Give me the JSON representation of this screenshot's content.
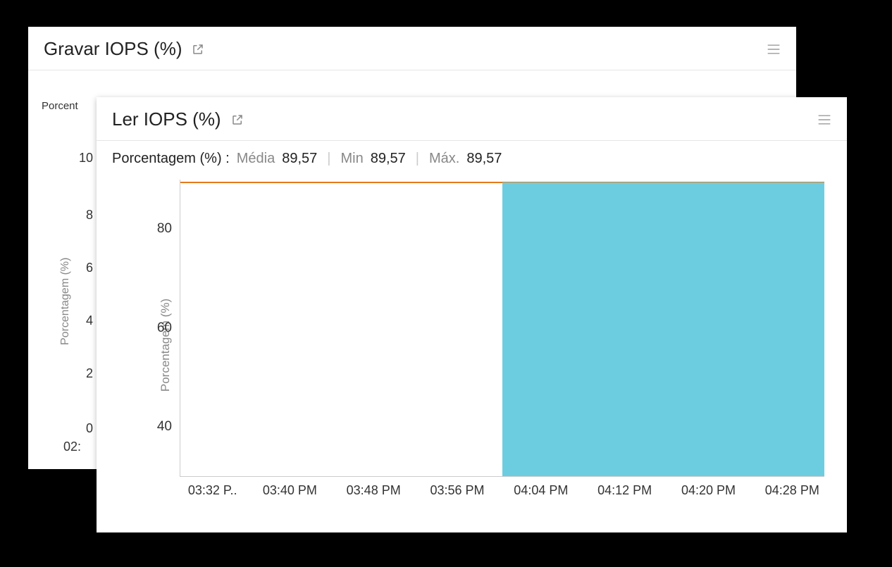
{
  "back_panel": {
    "title": "Gravar IOPS (%)",
    "y_label_truncated": "Porcent",
    "y_axis_rotated": "Porcentagem (%)",
    "y_ticks": [
      "10",
      "8",
      "6",
      "4",
      "2",
      "0"
    ],
    "x_tick_truncated": "02:"
  },
  "front_panel": {
    "title": "Ler IOPS (%)",
    "stats": {
      "label": "Porcentagem (%) :",
      "items": [
        {
          "name": "Média",
          "value": "89,57"
        },
        {
          "name": "Min",
          "value": "89,57"
        },
        {
          "name": "Máx.",
          "value": "89,57"
        }
      ]
    },
    "y_axis_label": "Porcentagem (%)",
    "y_ticks": [
      "80",
      "60",
      "40"
    ],
    "x_ticks": [
      "03:32 P..",
      "03:40 PM",
      "03:48 PM",
      "03:56 PM",
      "04:04 PM",
      "04:12 PM",
      "04:20 PM",
      "04:28 PM"
    ]
  },
  "chart_data": {
    "type": "area",
    "title": "Ler IOPS (%)",
    "xlabel": "",
    "ylabel": "Porcentagem (%)",
    "ylim": [
      30,
      90
    ],
    "x": [
      "03:32 PM",
      "03:40 PM",
      "03:48 PM",
      "03:56 PM",
      "04:04 PM",
      "04:12 PM",
      "04:20 PM",
      "04:28 PM"
    ],
    "series": [
      {
        "name": "Porcentagem (%)",
        "values": [
          null,
          null,
          null,
          null,
          89.57,
          89.57,
          89.57,
          89.57
        ]
      }
    ],
    "threshold_line": 89.57
  }
}
